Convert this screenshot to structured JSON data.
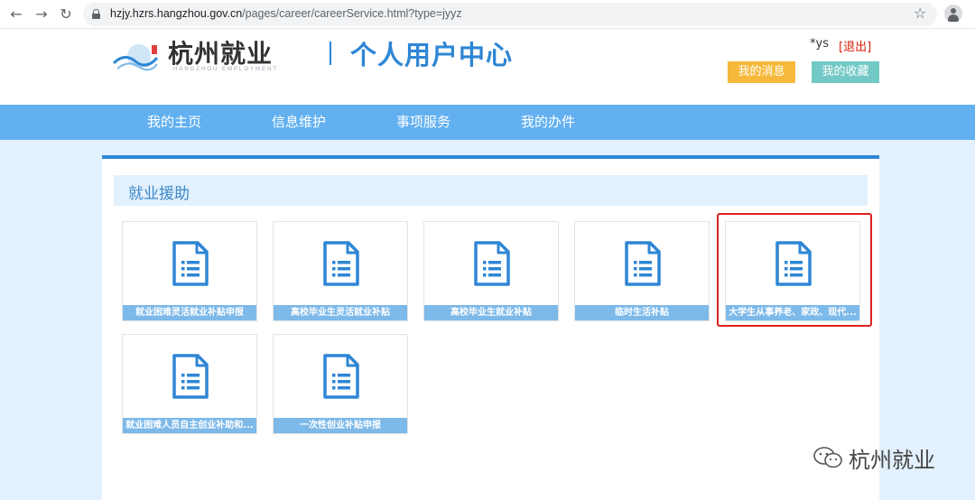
{
  "browser": {
    "back_icon": "arrow-left-icon",
    "forward_icon": "arrow-right-icon",
    "reload_icon": "reload-icon",
    "url_host": "hzjy.hzrs.hangzhou.gov.cn",
    "url_path": "/pages/career/careerService.html?type=jyyz",
    "bookmark_icon": "star-icon",
    "profile_icon": "profile-avatar-icon"
  },
  "header": {
    "logo_text": "杭州就业",
    "logo_sub": "HANGZHOU EMPLOYMENT",
    "title": "个人用户中心",
    "user_name": "*ys",
    "logout_label": "[退出]",
    "messages_label": "我的消息",
    "favorites_label": "我的收藏"
  },
  "nav": {
    "items": [
      {
        "label": "我的主页"
      },
      {
        "label": "信息维护"
      },
      {
        "label": "事项服务"
      },
      {
        "label": "我的办件"
      }
    ]
  },
  "section": {
    "title": "就业援助"
  },
  "cards": [
    {
      "label": "就业困难灵活就业补贴申报",
      "icon": "document-icon"
    },
    {
      "label": "高校毕业生灵活就业补贴",
      "icon": "document-icon"
    },
    {
      "label": "高校毕业生就业补贴",
      "icon": "document-icon"
    },
    {
      "label": "临时生活补贴",
      "icon": "document-icon"
    },
    {
      "label": "大学生从事养老、家政、现代...",
      "icon": "document-icon",
      "highlighted": true
    },
    {
      "label": "就业困难人员自主创业补助和...",
      "icon": "document-icon"
    },
    {
      "label": "一次性创业补贴申报",
      "icon": "document-icon"
    }
  ],
  "watermark": {
    "text": "杭州就业",
    "icon": "wechat-icon"
  },
  "colors": {
    "brand_blue": "#2e86d4",
    "nav_blue": "#62b0f0",
    "label_blue": "#7db9e9",
    "highlight_red": "#e02020",
    "messages_orange": "#f6b93b",
    "favorites_teal": "#72c9c5"
  }
}
